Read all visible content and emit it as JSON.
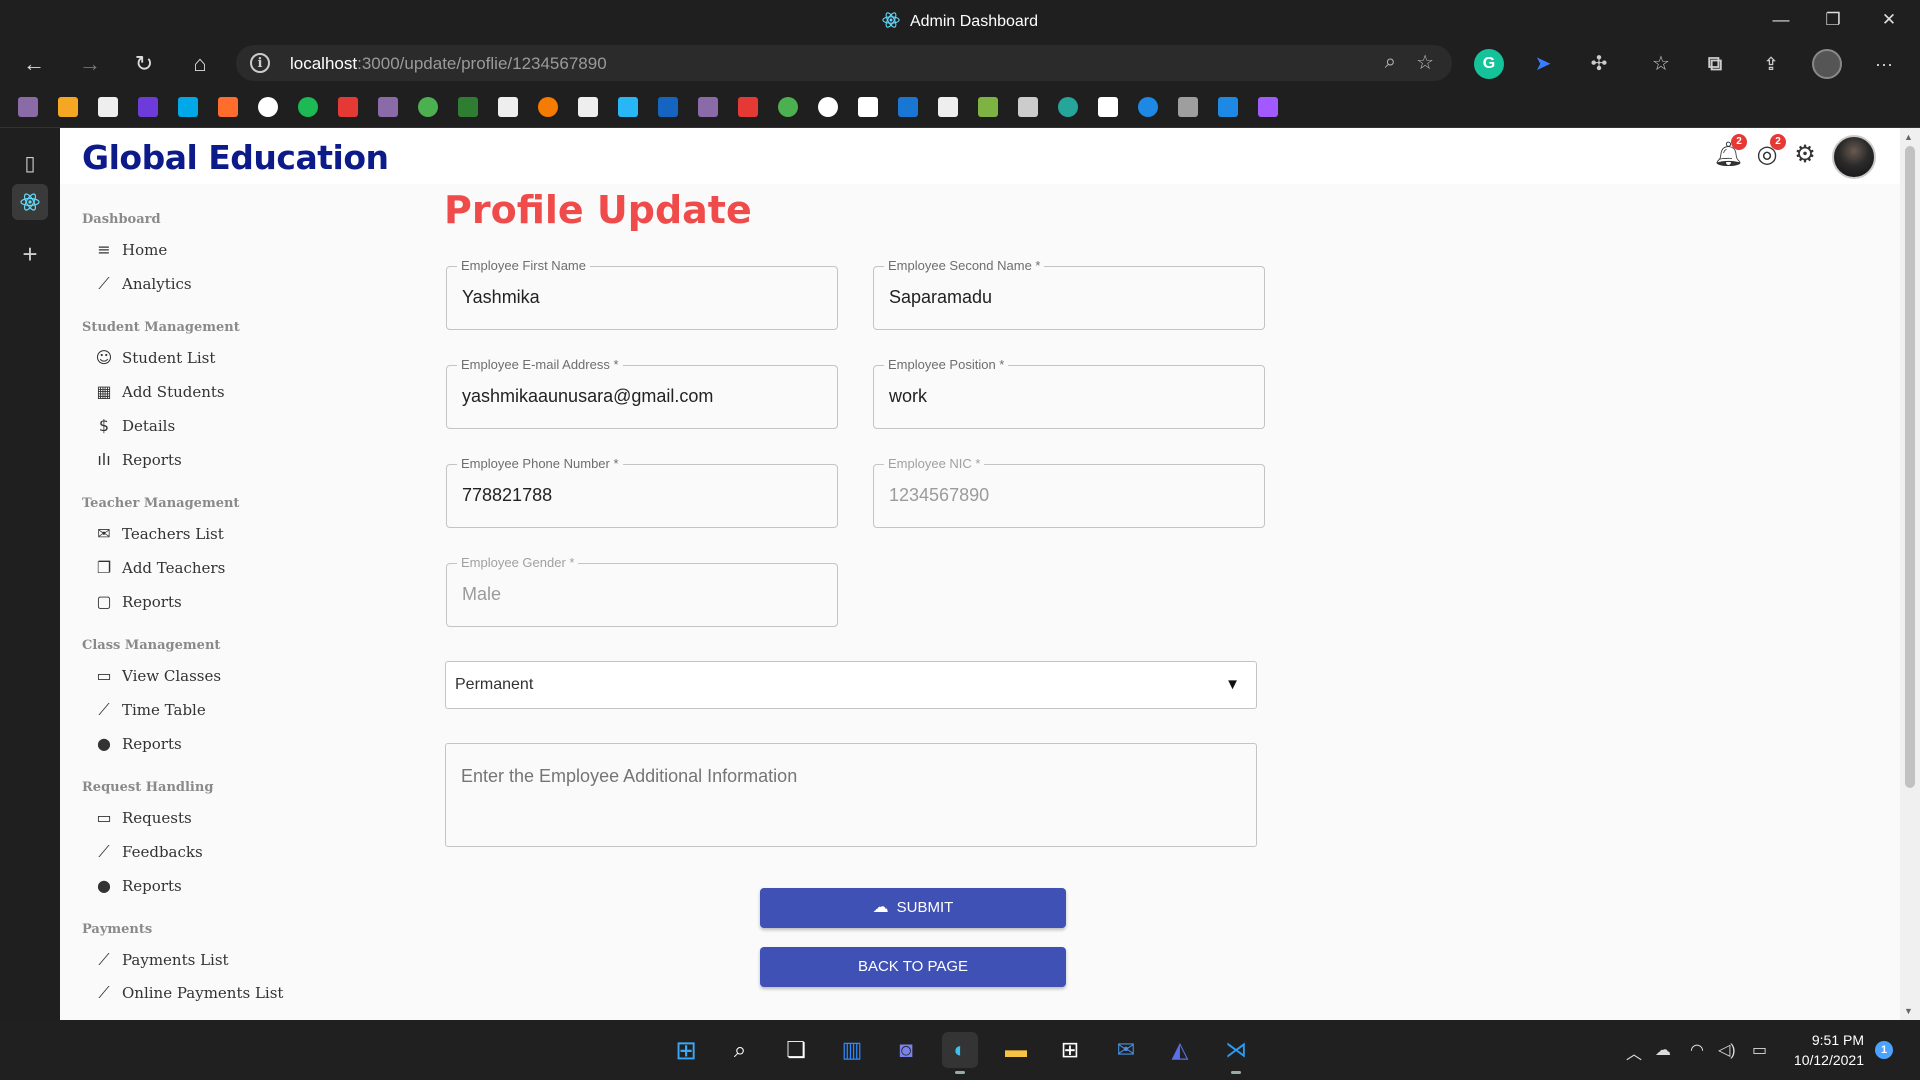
{
  "window": {
    "title": "Admin Dashboard",
    "controls": {
      "minimize": "—",
      "restore": "❐",
      "close": "✕"
    }
  },
  "browser": {
    "url_host": "localhost",
    "url_path": ":3000/update/proflie/1234567890",
    "buttons": {
      "back": "←",
      "forward": "→",
      "refresh": "↻",
      "home": "⌂",
      "more": "···"
    }
  },
  "app": {
    "brand": "Global Education",
    "notifications_count": "2",
    "language_count": "2"
  },
  "sidebar": {
    "sections": [
      {
        "title": "Dashboard",
        "items": [
          {
            "label": "Home",
            "icon": "≡"
          },
          {
            "label": "Analytics",
            "icon": "⟋"
          }
        ]
      },
      {
        "title": "Student Management",
        "items": [
          {
            "label": "Student List",
            "icon": "☺"
          },
          {
            "label": "Add Students",
            "icon": "▦"
          },
          {
            "label": "Details",
            "icon": "$"
          },
          {
            "label": "Reports",
            "icon": "ılı"
          }
        ]
      },
      {
        "title": "Teacher Management",
        "items": [
          {
            "label": "Teachers List",
            "icon": "✉"
          },
          {
            "label": "Add Teachers",
            "icon": "❐"
          },
          {
            "label": "Reports",
            "icon": "▢"
          }
        ]
      },
      {
        "title": "Class Management",
        "items": [
          {
            "label": "View Classes",
            "icon": "▭"
          },
          {
            "label": "Time Table",
            "icon": "⟋"
          },
          {
            "label": "Reports",
            "icon": "●"
          }
        ]
      },
      {
        "title": "Request Handling",
        "items": [
          {
            "label": "Requests",
            "icon": "▭"
          },
          {
            "label": "Feedbacks",
            "icon": "⟋"
          },
          {
            "label": "Reports",
            "icon": "●"
          }
        ]
      },
      {
        "title": "Payments",
        "items": [
          {
            "label": "Payments List",
            "icon": "⟋"
          },
          {
            "label": "Online Payments List",
            "icon": "⟋"
          }
        ]
      }
    ]
  },
  "form": {
    "title": "Profile Update",
    "first_name": {
      "label": "Employee First Name",
      "value": "Yashmika"
    },
    "second_name": {
      "label": "Employee Second Name *",
      "value": "Saparamadu"
    },
    "email": {
      "label": "Employee E-mail Address *",
      "value": "yashmikaaunusara@gmail.com"
    },
    "position": {
      "label": "Employee Position *",
      "value": "work"
    },
    "phone": {
      "label": "Employee Phone Number *",
      "value": "778821788"
    },
    "nic": {
      "label": "Employee NIC *",
      "value": "1234567890"
    },
    "gender": {
      "label": "Employee Gender *",
      "value": "Male"
    },
    "employment_type": {
      "selected": "Permanent",
      "arrow": "▼"
    },
    "additional_info": {
      "placeholder": "Enter the Employee Additional Information"
    },
    "submit_label": "SUBMIT",
    "back_label": "BACK TO PAGE"
  },
  "taskbar": {
    "time": "9:51 PM",
    "date": "10/12/2021",
    "notification_count": "1"
  }
}
